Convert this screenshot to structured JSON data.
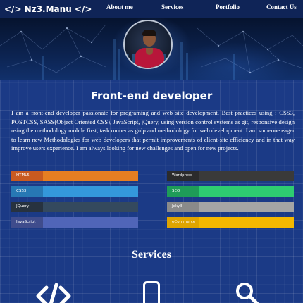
{
  "nav": {
    "brand": "</> Nz3.Manu </>",
    "links": [
      "About me",
      "Services",
      "Portfolio",
      "Contact Us"
    ]
  },
  "hero": {
    "title": "Front-end developer",
    "intro": "I am a front-end developer passionate for programing and web site development. Best practices using : CSS3, POSTCSS, SASS(Object Oriented CSS), JavaScript, jQuery, using version control systems as git, responsive design using the methodology mobile first, task runner as gulp and methodology for web development. I am someone eager to learn new Methodologies for web developers that permit improvements of client-site efficiency and in that way improve users experience. I am always looking for new challenges and open for new projects."
  },
  "skills": [
    {
      "label": "HTML5",
      "label_color": "#c85a20",
      "bar_color": "#e67e22"
    },
    {
      "label": "CSS3",
      "label_color": "#2778b4",
      "bar_color": "#3498db"
    },
    {
      "label": "JQuery",
      "label_color": "#27323f",
      "bar_color": "#34495e"
    },
    {
      "label": "JavaScript",
      "label_color": "#3f4c8c",
      "bar_color": "#5065b8"
    },
    {
      "label": "Wordpress",
      "label_color": "#2b2b2b",
      "bar_color": "#3a3a3a"
    },
    {
      "label": "SEO",
      "label_color": "#1e9c58",
      "bar_color": "#2ecc71"
    },
    {
      "label": "JekyII",
      "label_color": "#8a8a8a",
      "bar_color": "#a5a5a5"
    },
    {
      "label": "eCommerce",
      "label_color": "#e0a400",
      "bar_color": "#f5b800"
    }
  ],
  "services": {
    "title": "Services",
    "icons": [
      "code-icon",
      "smartphone-icon",
      "search-icon"
    ]
  },
  "colors": {
    "background": "#1b3a86",
    "navbar": "#0f2457"
  }
}
